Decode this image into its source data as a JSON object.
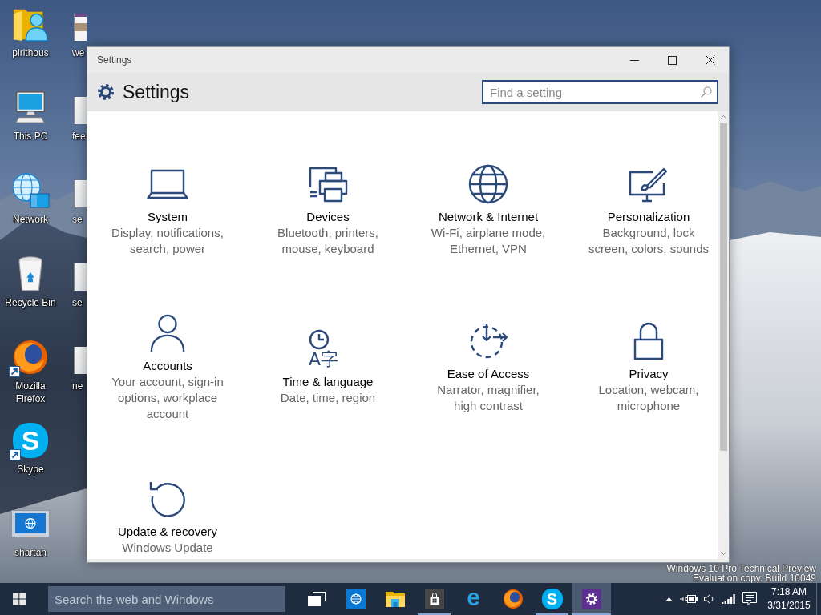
{
  "desktop": {
    "icons": [
      {
        "label": "pirithous",
        "kind": "user-folder",
        "shortcut": false
      },
      {
        "label": "This PC",
        "kind": "monitor",
        "shortcut": false
      },
      {
        "label": "Network",
        "kind": "network",
        "shortcut": false
      },
      {
        "label": "Recycle Bin",
        "kind": "recycle-bin",
        "shortcut": false
      },
      {
        "label": "Mozilla Firefox",
        "kind": "fox-globe",
        "shortcut": true
      },
      {
        "label": "Skype",
        "kind": "s-cloud",
        "letter": "S",
        "shortcut": true
      },
      {
        "label": "shartan",
        "kind": "thumbnail",
        "shortcut": false
      }
    ],
    "covered_icons": [
      {
        "label": "we"
      },
      {
        "label": "fee"
      },
      {
        "label": "se"
      },
      {
        "label": "se"
      },
      {
        "label": "ne"
      }
    ],
    "notice": [
      "Windows 10 Pro Technical Preview",
      "Evaluation copy. Build 10049"
    ]
  },
  "window": {
    "title": "Settings",
    "heading": "Settings",
    "search": {
      "placeholder": "Find a setting"
    },
    "categories": [
      {
        "name": "System",
        "description": "Display, notifications,\nsearch, power",
        "kind": "laptop"
      },
      {
        "name": "Devices",
        "description": "Bluetooth, printers,\nmouse, keyboard",
        "kind": "devices"
      },
      {
        "name": "Network & Internet",
        "description": "Wi-Fi, airplane mode,\nEthernet, VPN",
        "kind": "globe"
      },
      {
        "name": "Personalization",
        "description": "Background, lock\nscreen, colors, sounds",
        "kind": "brush-monitor"
      },
      {
        "name": "Accounts",
        "description": "Your account, sign-in\noptions, workplace\naccount",
        "kind": "person"
      },
      {
        "name": "Time & language",
        "description": "Date, time, region",
        "kind": "clock-glyphs",
        "glyphs": "A字"
      },
      {
        "name": "Ease of Access",
        "description": "Narrator, magnifier,\nhigh contrast",
        "kind": "dashed-circle"
      },
      {
        "name": "Privacy",
        "description": "Location, webcam,\nmicrophone",
        "kind": "lock"
      },
      {
        "name": "Update & recovery",
        "description": "Windows Update",
        "kind": "circular-arrow"
      }
    ]
  },
  "taskbar": {
    "search": {
      "placeholder": "Search the web and Windows"
    },
    "apps": [
      {
        "kind": "task-view",
        "running": false,
        "selected": false
      },
      {
        "kind": "globe-tile",
        "running": false,
        "selected": false
      },
      {
        "kind": "folder",
        "running": false,
        "selected": false
      },
      {
        "kind": "store",
        "running": true,
        "selected": false
      },
      {
        "kind": "e-letter",
        "letter": "e",
        "running": false,
        "selected": false
      },
      {
        "kind": "fox-globe",
        "running": false,
        "selected": false
      },
      {
        "kind": "s-cloud",
        "letter": "S",
        "running": true,
        "selected": false
      },
      {
        "kind": "gear-tile",
        "running": true,
        "selected": true
      }
    ],
    "clock": {
      "time": "7:18 AM",
      "date": "3/31/2015"
    }
  }
}
